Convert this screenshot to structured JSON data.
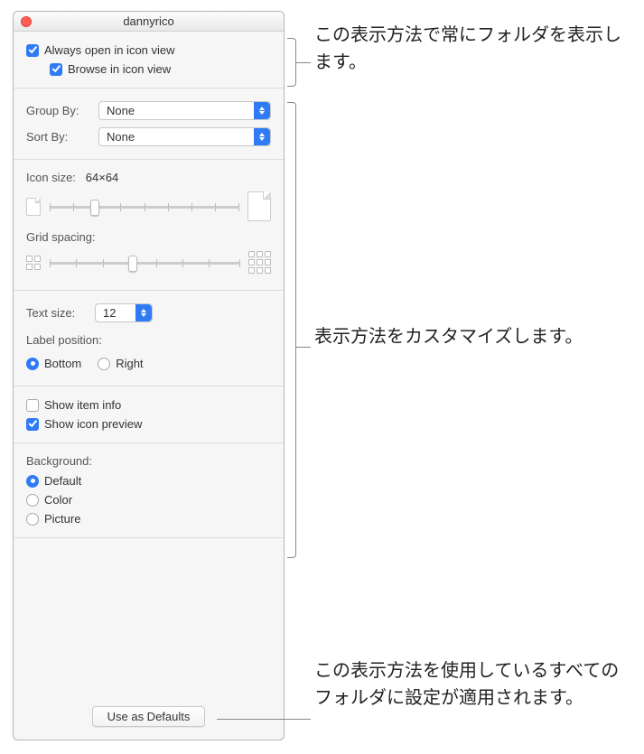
{
  "window": {
    "title": "dannyrico"
  },
  "alwaysOpen": {
    "label": "Always open in icon view",
    "checked": true,
    "browseLabel": "Browse in icon view",
    "browseChecked": true
  },
  "groupBy": {
    "label": "Group By:",
    "value": "None"
  },
  "sortBy": {
    "label": "Sort By:",
    "value": "None"
  },
  "iconSize": {
    "label": "Icon size:",
    "value": "64×64"
  },
  "gridSpacing": {
    "label": "Grid spacing:"
  },
  "textSize": {
    "label": "Text size:",
    "value": "12"
  },
  "labelPosition": {
    "label": "Label position:",
    "bottom": "Bottom",
    "right": "Right",
    "value": "bottom"
  },
  "showItemInfo": {
    "label": "Show item info",
    "checked": false
  },
  "showIconPreview": {
    "label": "Show icon preview",
    "checked": true
  },
  "background": {
    "label": "Background:",
    "default": "Default",
    "color": "Color",
    "picture": "Picture",
    "value": "default"
  },
  "useDefaults": "Use as Defaults",
  "annotations": {
    "top": "この表示方法で常にフォルダを表示します。",
    "middle": "表示方法をカスタマイズします。",
    "bottom": "この表示方法を使用しているすべてのフォルダに設定が適用されます。"
  }
}
